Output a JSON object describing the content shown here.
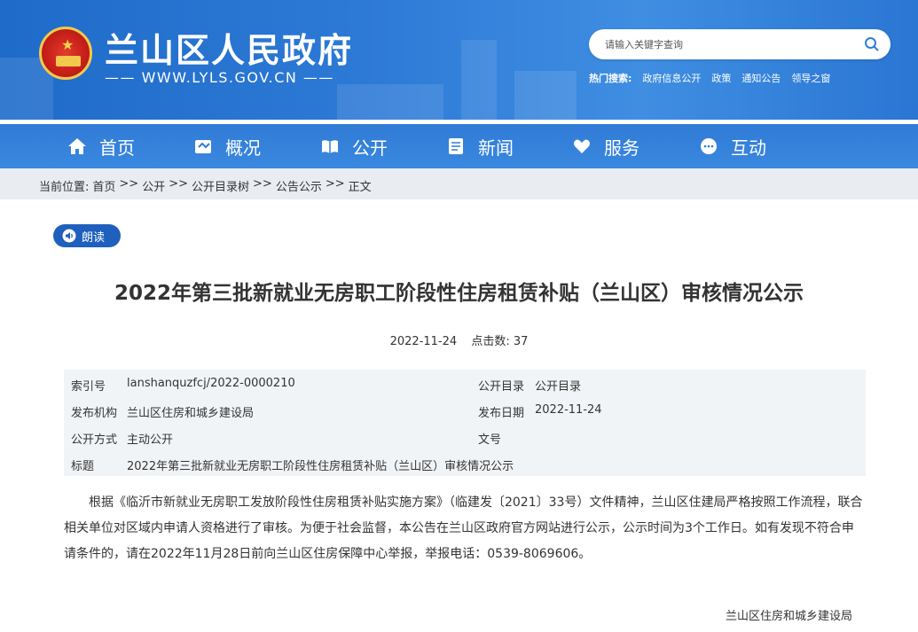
{
  "header": {
    "site_title": "兰山区人民政府",
    "site_url": "—— WWW.LYLS.GOV.CN ——",
    "search_placeholder": "请输入关键字查询",
    "hot_label": "热门搜索:",
    "hot_links": [
      "政府信息公开",
      "政策",
      "通知公告",
      "领导之窗"
    ]
  },
  "nav": {
    "items": [
      {
        "label": "首页",
        "icon": "home-icon"
      },
      {
        "label": "概况",
        "icon": "overview-icon"
      },
      {
        "label": "公开",
        "icon": "book-icon"
      },
      {
        "label": "新闻",
        "icon": "news-icon"
      },
      {
        "label": "服务",
        "icon": "heart-hand-icon"
      },
      {
        "label": "互动",
        "icon": "chat-icon"
      }
    ]
  },
  "breadcrumb": {
    "prefix": "当前位置:",
    "items": [
      "首页",
      ">>",
      "公开",
      ">>",
      "公开目录树",
      ">>",
      "公告公示",
      ">>",
      "正文"
    ]
  },
  "read_button": "朗读",
  "article": {
    "title": "2022年第三批新就业无房职工阶段性住房租赁补贴（兰山区）审核情况公示",
    "date": "2022-11-24",
    "views_label": "点击数:",
    "views": "37"
  },
  "info": {
    "index_label": "索引号",
    "index_value": "lanshanquzfcj/2022-0000210",
    "catalog_label": "公开目录",
    "catalog_value": "公开目录",
    "publisher_label": "发布机构",
    "publisher_value": "兰山区住房和城乡建设局",
    "pubdate_label": "发布日期",
    "pubdate_value": "2022-11-24",
    "mode_label": "公开方式",
    "mode_value": "主动公开",
    "docno_label": "文号",
    "docno_value": "",
    "subject_label": "标题",
    "subject_value": "2022年第三批新就业无房职工阶段性住房租赁补贴（兰山区）审核情况公示"
  },
  "body_text": "根据《临沂市新就业无房职工发放阶段性住房租赁补贴实施方案》（临建发〔2021〕33号）文件精神，兰山区住建局严格按照工作流程，联合相关单位对区域内申请人资格进行了审核。为便于社会监督，本公告在兰山区政府官方网站进行公示，公示时间为3个工作日。如有发现不符合申请条件的，请在2022年11月28日前向兰山区住房保障中心举报，举报电话：0539-8069606。",
  "signature": "兰山区住房和城乡建设局",
  "colors": {
    "header_blue": "#2f7ed8",
    "button_blue": "#1f5fbd",
    "crumb_bg": "#e9edf2",
    "info_bg": "#f1f4f7"
  }
}
